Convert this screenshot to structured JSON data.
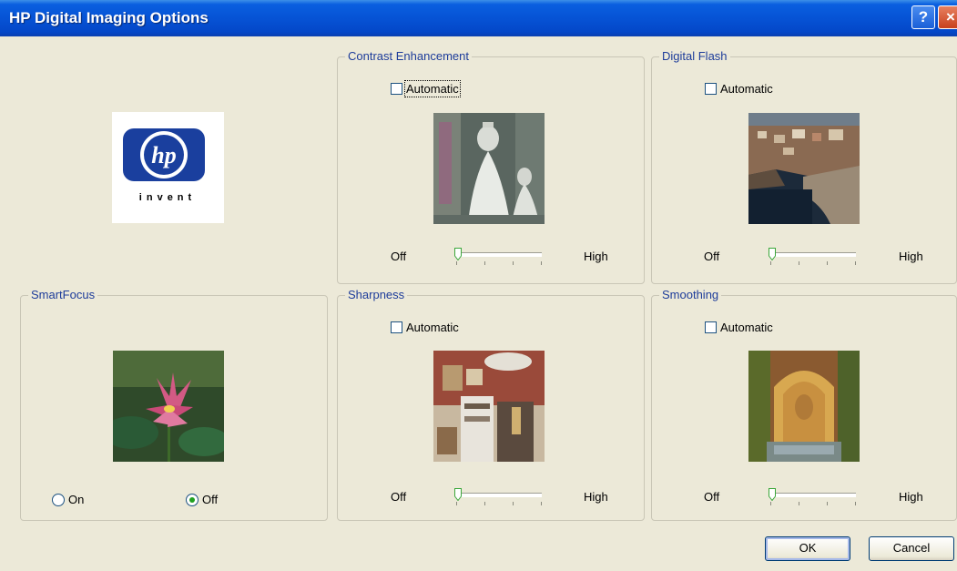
{
  "window": {
    "title": "HP Digital Imaging Options",
    "help_glyph": "?",
    "close_glyph": "×"
  },
  "logo": {
    "mark": "hp",
    "tagline": "invent",
    "brand_color": "#1a3f9e"
  },
  "colors": {
    "accent": "#0653d5",
    "group_label": "#1d3c9a",
    "slider_thumb": "#3aa63a"
  },
  "groups": {
    "contrast": {
      "label": "Contrast Enhancement",
      "automatic": "Automatic",
      "automatic_checked": false,
      "off": "Off",
      "high": "High",
      "level": 0
    },
    "flash": {
      "label": "Digital Flash",
      "automatic": "Automatic",
      "automatic_checked": false,
      "off": "Off",
      "high": "High",
      "level": 0
    },
    "smartfocus": {
      "label": "SmartFocus",
      "on": "On",
      "off": "Off",
      "selected": "Off"
    },
    "sharpness": {
      "label": "Sharpness",
      "automatic": "Automatic",
      "automatic_checked": false,
      "off": "Off",
      "high": "High",
      "level": 0
    },
    "smoothing": {
      "label": "Smoothing",
      "automatic": "Automatic",
      "automatic_checked": false,
      "off": "Off",
      "high": "High",
      "level": 0
    }
  },
  "buttons": {
    "ok": "OK",
    "cancel": "Cancel"
  }
}
